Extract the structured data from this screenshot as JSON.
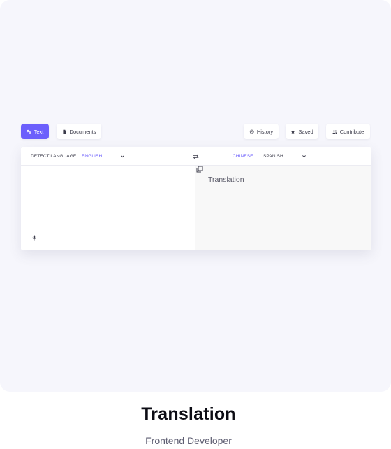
{
  "toolbar": {
    "text_label": "Text",
    "documents_label": "Documents",
    "history_label": "History",
    "saved_label": "Saved",
    "contribute_label": "Contribute"
  },
  "source_languages": {
    "detect": "DETECT LANGUAGE",
    "active": "ENGLISH"
  },
  "target_languages": {
    "active": "CHINESE",
    "second": "SPANISH"
  },
  "output": {
    "placeholder": "Translation"
  },
  "caption": {
    "title": "Translation",
    "subtitle": "Frontend Developer"
  },
  "colors": {
    "accent": "#6c5ffc",
    "background": "#f6f6fc"
  },
  "icons": [
    "translate-icon",
    "document-icon",
    "history-icon",
    "star-icon",
    "people-icon",
    "chevron-down-icon",
    "swap-icon",
    "copy-icon",
    "microphone-icon"
  ]
}
